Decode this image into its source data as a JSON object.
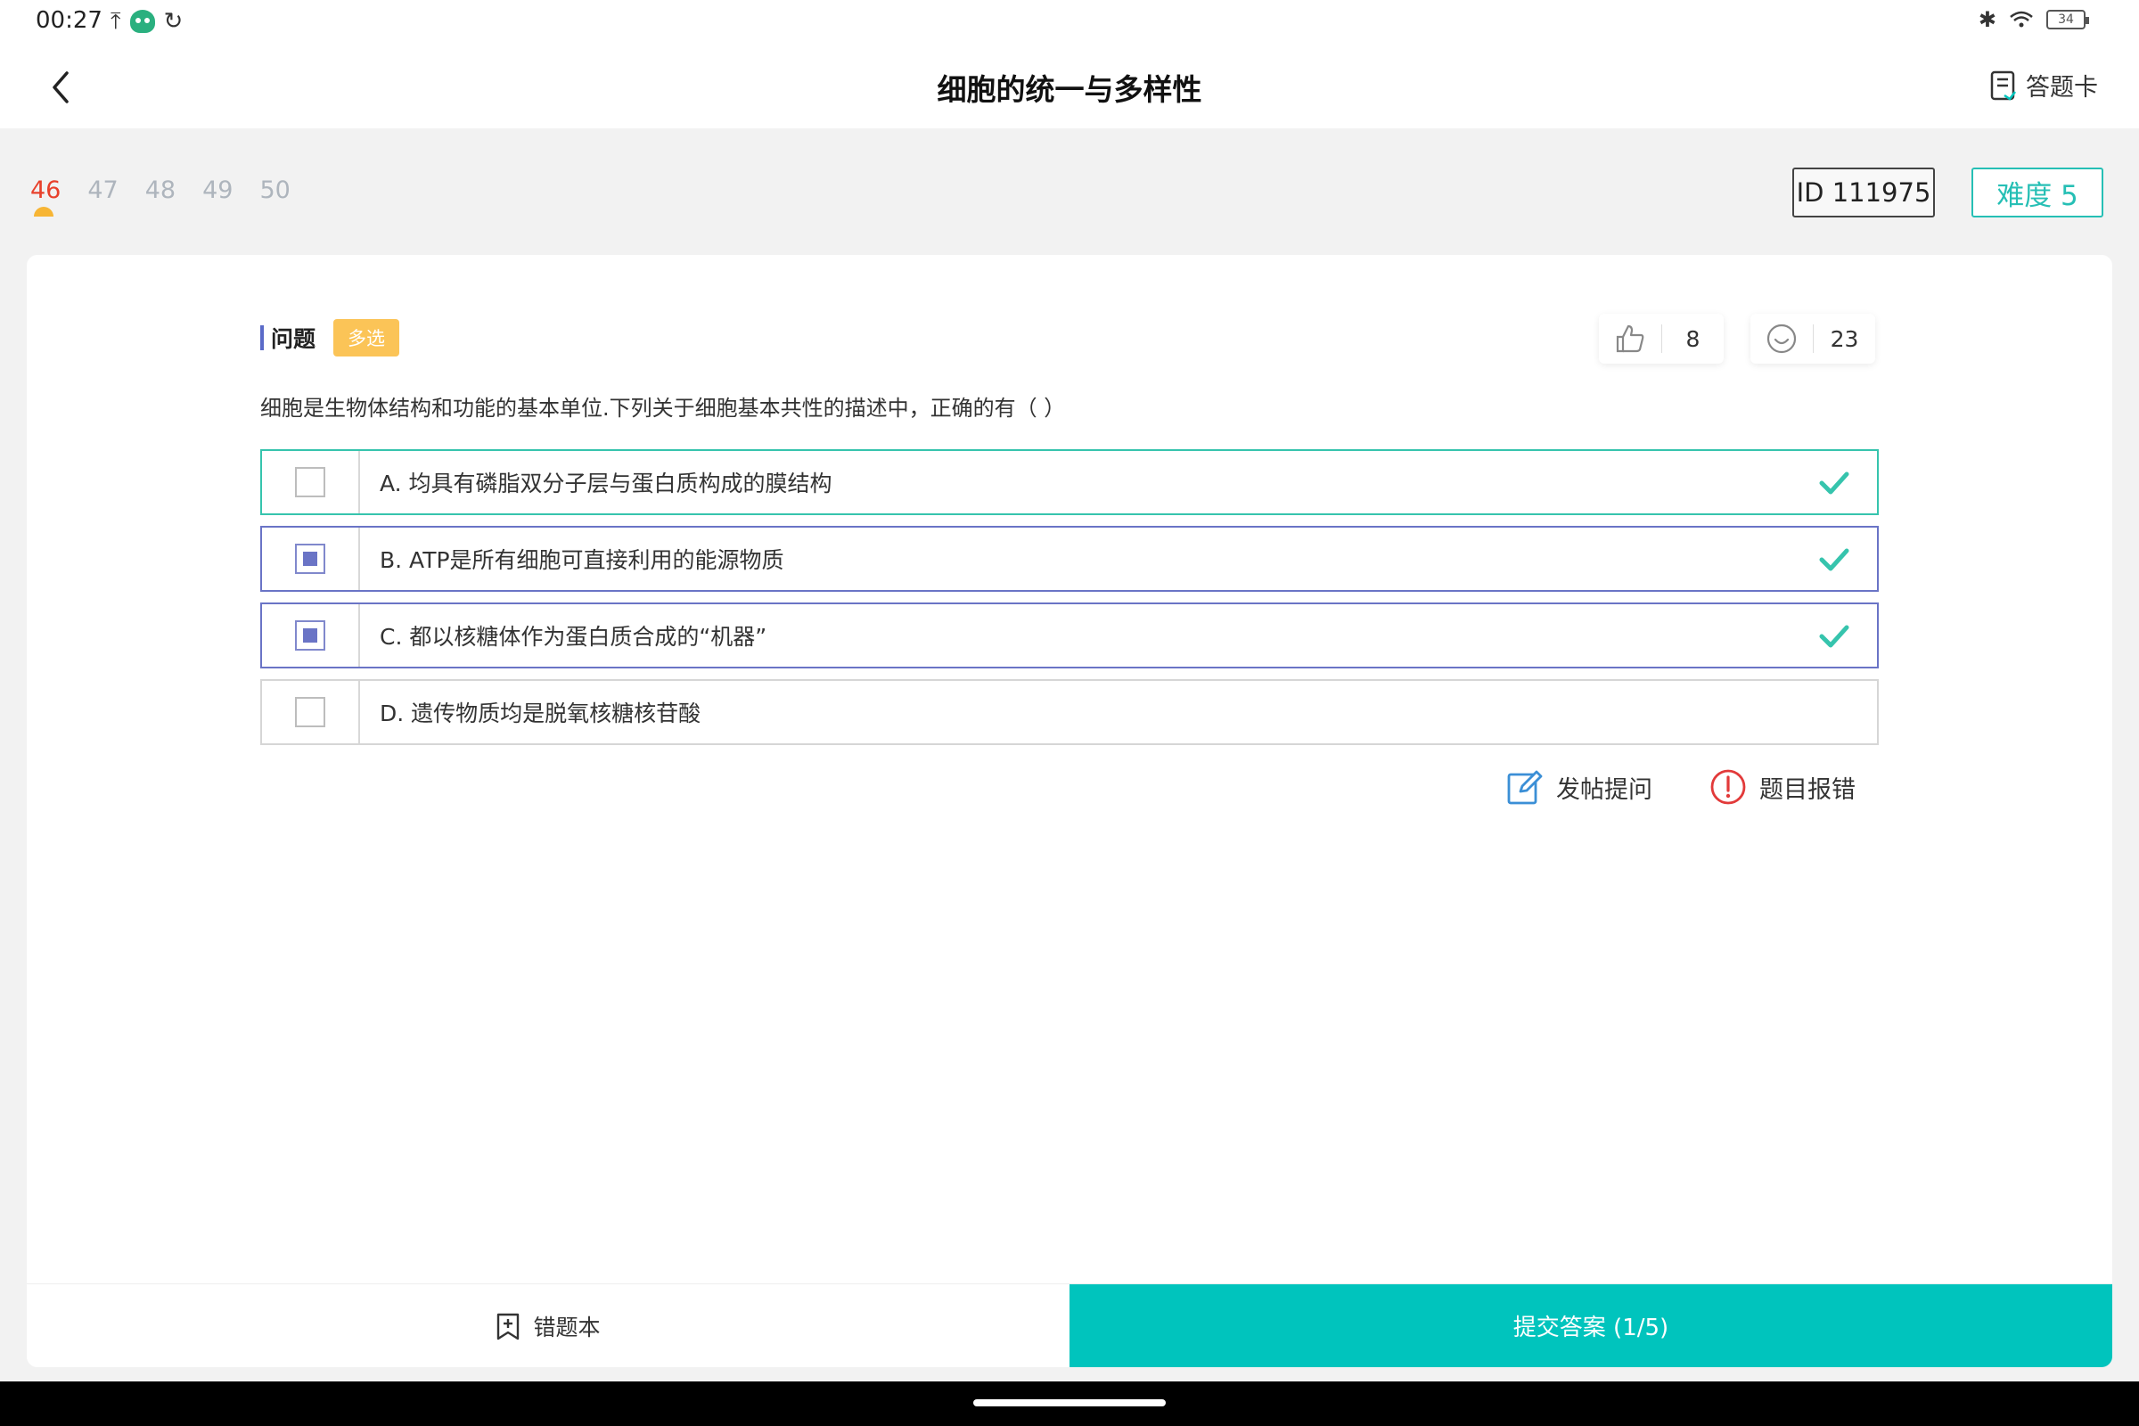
{
  "status_bar": {
    "time": "00:27",
    "battery": "34"
  },
  "header": {
    "title": "细胞的统一与多样性",
    "answer_card_label": "答题卡"
  },
  "question_nav": {
    "numbers": [
      "46",
      "47",
      "48",
      "49",
      "50"
    ],
    "active_index": 0,
    "id_label": "ID 111975",
    "difficulty_label": "难度 5"
  },
  "question": {
    "section_label": "问题",
    "type_tag": "多选",
    "like_count": "8",
    "comment_count": "23",
    "text": "细胞是生物体结构和功能的基本单位.下列关于细胞基本共性的描述中，正确的有（ ）",
    "options": [
      {
        "text": "A. 均具有磷脂双分子层与蛋白质构成的膜结构",
        "selected": false,
        "correct": true
      },
      {
        "text": "B. ATP是所有细胞可直接利用的能源物质",
        "selected": true,
        "correct": true
      },
      {
        "text": "C. 都以核糖体作为蛋白质合成的“机器”",
        "selected": true,
        "correct": true
      },
      {
        "text": "D. 遗传物质均是脱氧核糖核苷酸",
        "selected": false,
        "correct": false
      }
    ]
  },
  "actions": {
    "post_question": "发帖提问",
    "report_error": "题目报错"
  },
  "bottom_bar": {
    "wrong_book": "错题本",
    "submit": "提交答案 (1/5)"
  },
  "colors": {
    "accent": "#00c4bd",
    "correct": "#36c4ad",
    "selected": "#6a74c6",
    "tag": "#fbc457",
    "active_number": "#e8412c",
    "report": "#e23a3a",
    "edit": "#3b8fd6"
  }
}
